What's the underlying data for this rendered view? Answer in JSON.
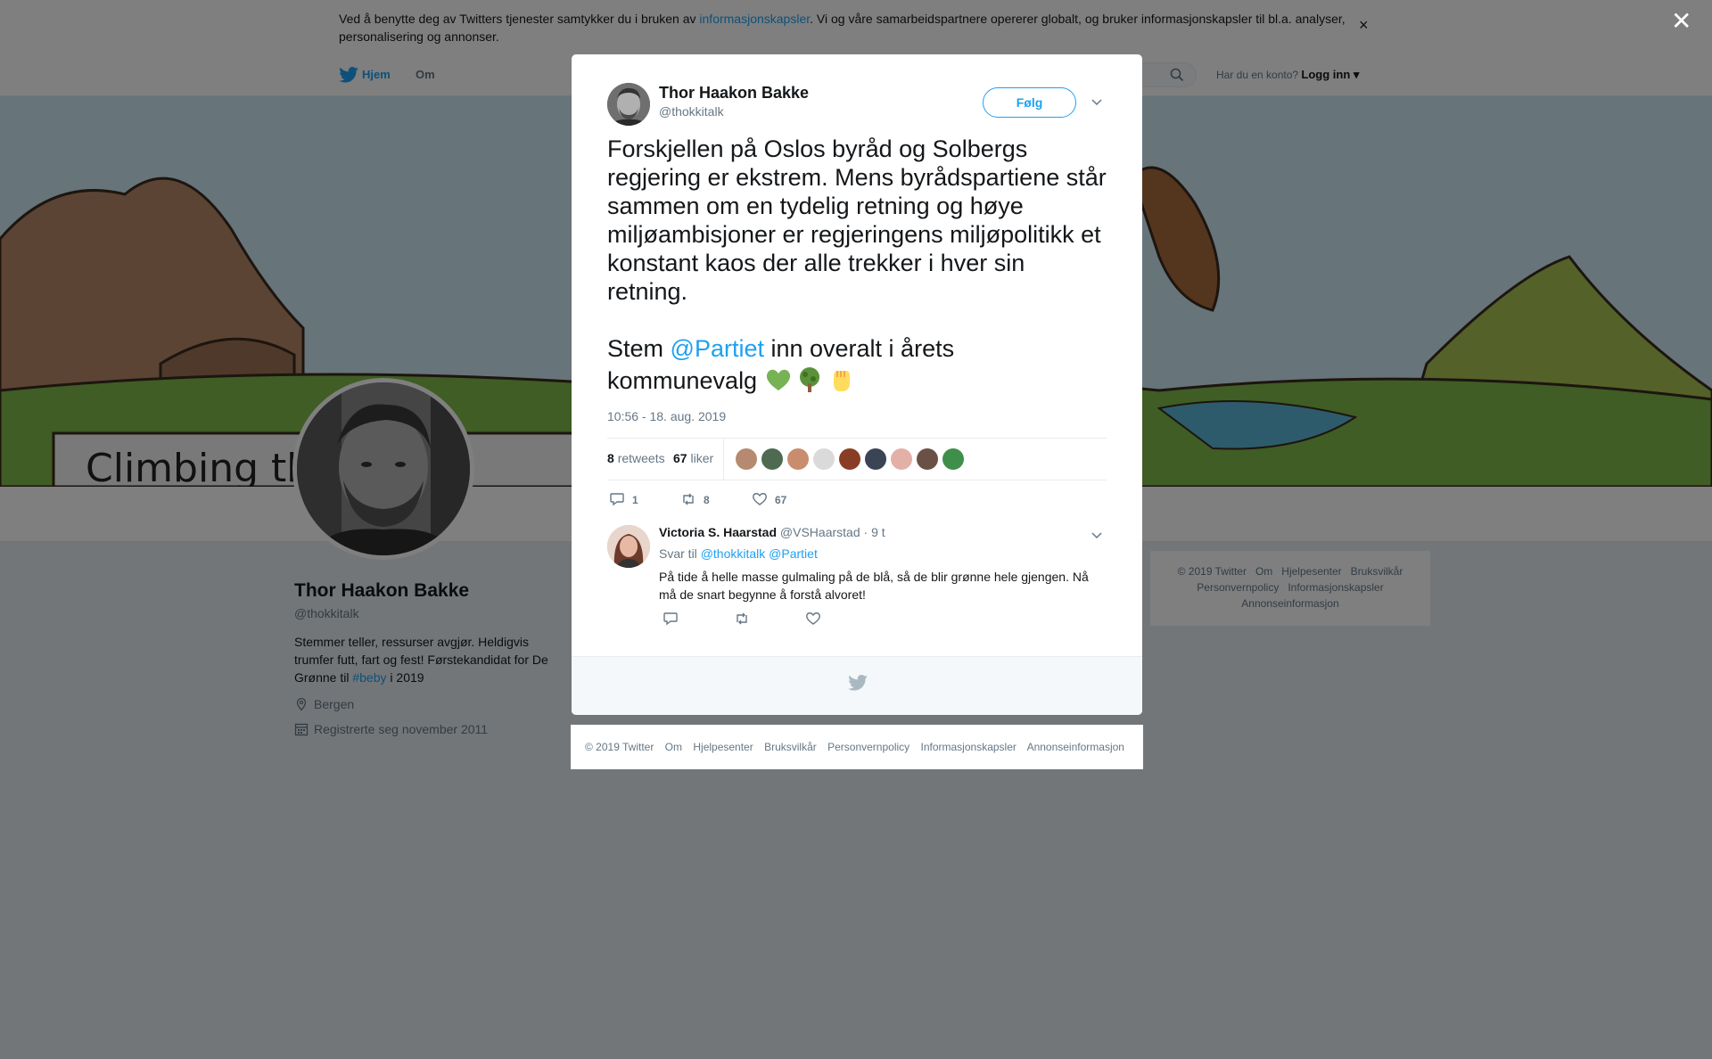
{
  "cookie": {
    "text_before": "Ved å benytte deg av Twitters tjenester samtykker du i bruken av ",
    "link": "informasjonskapsler",
    "text_after": ". Vi og våre samarbeidspartnere opererer globalt, og bruker informasjonskapsler til bl.a. analyser, personalisering og annonser.",
    "close": "×"
  },
  "nav": {
    "home": "Hjem",
    "about": "Om",
    "account_prompt": "Har du en konto?",
    "login": "Logg inn"
  },
  "banner": {
    "text": "Climbing th          large"
  },
  "profile": {
    "name": "Thor Haakon Bakke",
    "handle": "@thokkitalk",
    "bio_1": "Stemmer teller, ressurser avgjør. Heldigvis trumfer futt, fart og fest! Førstekandidat for De Grønne til ",
    "bio_tag": "#beby",
    "bio_2": " i 2019",
    "location": "Bergen",
    "joined": "Registrerte seg november 2011"
  },
  "side_footer": {
    "items": [
      "© 2019 Twitter",
      "Om",
      "Hjelpesenter",
      "Bruksvilkår",
      "Personvernpolicy",
      "Informasjonskapsler",
      "Annonseinformasjon"
    ]
  },
  "overlay": {
    "close": "✕"
  },
  "tweet": {
    "name": "Thor Haakon Bakke",
    "handle": "@thokkitalk",
    "follow": "Følg",
    "text_1": "Forskjellen på Oslos byråd og Solbergs regjering er ekstrem. Mens byrådspartiene står sammen om en tydelig retning og høye miljøambisjoner er regjeringens miljøpolitikk et konstant kaos der alle trekker i hver sin retning.",
    "text_2_before": "Stem ",
    "text_2_mention": "@Partiet",
    "text_2_after": " inn overalt i årets kommunevalg",
    "time": "10:56 - 18. aug. 2019",
    "retweets_count": "8",
    "retweets_label": "retweets",
    "likes_count": "67",
    "likes_label": "liker",
    "reply_count": "1",
    "retweet_count": "8",
    "like_count": "67"
  },
  "reply": {
    "name": "Victoria S. Haarstad",
    "handle": "@VSHaarstad",
    "time": "· 9 t",
    "reply_to_label": "Svar til",
    "reply_to_1": "@thokkitalk",
    "reply_to_2": "@Partiet",
    "text": "På tide å helle masse gulmaling  på de blå, så de blir grønne hele gjengen. Nå må de snart begynne å forstå alvoret!"
  },
  "modal_footer": {
    "items": [
      "© 2019 Twitter",
      "Om",
      "Hjelpesenter",
      "Bruksvilkår",
      "Personvernpolicy",
      "Informasjonskapsler",
      "Annonseinformasjon"
    ]
  },
  "colors": {
    "accent": "#1da1f2",
    "text": "#14171a",
    "muted": "#657786",
    "heart": "#77b255"
  },
  "icons": [
    "twitter-bird-icon",
    "search-icon",
    "caret-down-icon",
    "location-icon",
    "calendar-icon",
    "reply-icon",
    "retweet-icon",
    "heart-icon",
    "close-icon"
  ]
}
